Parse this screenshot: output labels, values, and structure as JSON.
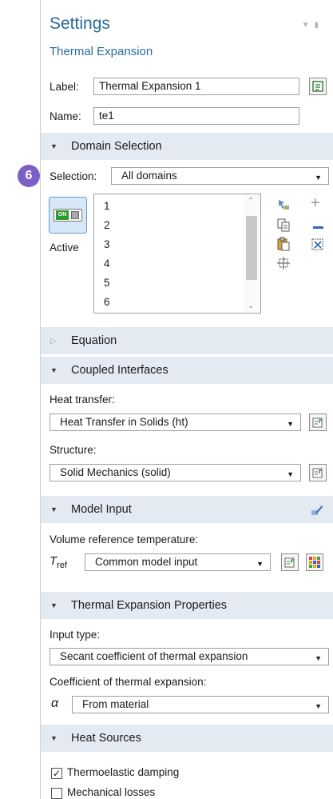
{
  "header": {
    "title": "Settings",
    "subtitle": "Thermal Expansion"
  },
  "label_row": {
    "label": "Label:",
    "value": "Thermal Expansion 1"
  },
  "name_row": {
    "label": "Name:",
    "value": "te1"
  },
  "step_badge": "6",
  "sections": {
    "domain_selection": "Domain Selection",
    "equation": "Equation",
    "coupled_interfaces": "Coupled Interfaces",
    "model_input": "Model Input",
    "thermal_expansion_properties": "Thermal Expansion Properties",
    "heat_sources": "Heat Sources"
  },
  "domain_selection": {
    "selection_label": "Selection:",
    "selection_value": "All domains",
    "active_label": "Active",
    "toggle_text": "ON",
    "domains": [
      "1",
      "2",
      "3",
      "4",
      "5",
      "6"
    ]
  },
  "coupled_interfaces": {
    "heat_transfer_label": "Heat transfer:",
    "heat_transfer_value": "Heat Transfer in Solids (ht)",
    "structure_label": "Structure:",
    "structure_value": "Solid Mechanics (solid)"
  },
  "model_input": {
    "volume_ref_label": "Volume reference temperature:",
    "tref_symbol": "T",
    "tref_sub": "ref",
    "tref_value": "Common model input"
  },
  "thermal_expansion_properties": {
    "input_type_label": "Input type:",
    "input_type_value": "Secant coefficient of thermal expansion",
    "coef_label": "Coefficient of thermal expansion:",
    "alpha_symbol": "α",
    "alpha_value": "From material"
  },
  "heat_sources": {
    "thermoelastic_label": "Thermoelastic damping",
    "thermoelastic_checked": true,
    "mechanical_label": "Mechanical losses",
    "mechanical_checked": false
  },
  "colors": {
    "section_bg": "#e4eaf2",
    "title_blue": "#2a6a9a",
    "badge_purple": "#7b5fc6",
    "toggle_green": "#2e9b2e"
  }
}
